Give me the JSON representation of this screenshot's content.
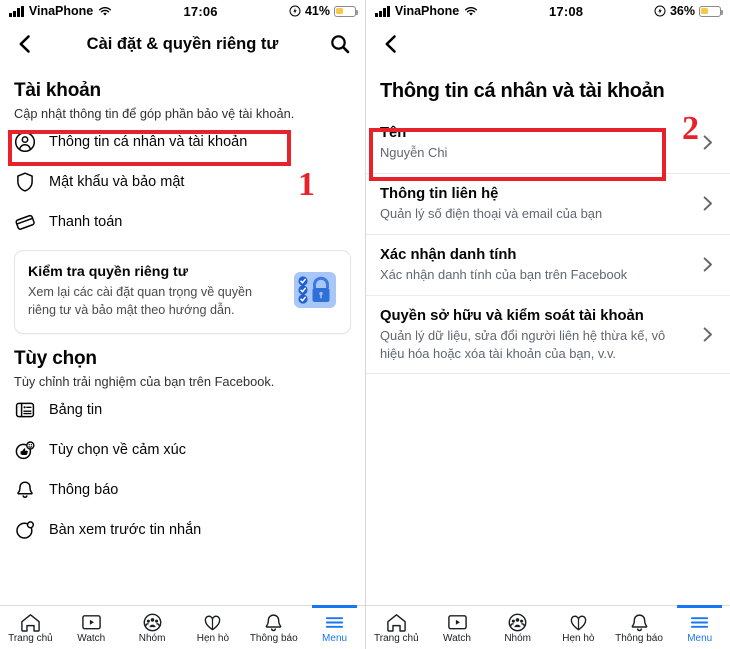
{
  "left": {
    "status": {
      "carrier": "VinaPhone",
      "time": "17:06",
      "battery_pct": "41%",
      "signal_icon": "signal-bars-icon",
      "wifi_icon": "wifi-icon",
      "battery_icon": "battery-icon",
      "lowpower_icon": "low-power-icon"
    },
    "nav": {
      "back_icon": "back-chevron-icon",
      "title": "Cài đặt & quyền riêng tư",
      "search_icon": "search-icon"
    },
    "account": {
      "title": "Tài khoản",
      "subtitle": "Cập nhật thông tin để góp phần bảo vệ tài khoản.",
      "items": [
        {
          "label": "Thông tin cá nhân và tài khoản",
          "icon": "person-circle-icon"
        },
        {
          "label": "Mật khẩu và bảo mật",
          "icon": "shield-icon"
        },
        {
          "label": "Thanh toán",
          "icon": "payment-card-icon"
        }
      ]
    },
    "privacy_card": {
      "title": "Kiểm tra quyền riêng tư",
      "desc": "Xem lại các cài đặt quan trọng về quyền riêng tư và bảo mật theo hướng dẫn.",
      "icon": "privacy-checkup-lock-icon"
    },
    "preferences": {
      "title": "Tùy chọn",
      "subtitle": "Tùy chỉnh trải nghiệm của bạn trên Facebook.",
      "items": [
        {
          "label": "Bảng tin",
          "icon": "newsfeed-icon"
        },
        {
          "label": "Tùy chọn về cảm xúc",
          "icon": "reactions-icon"
        },
        {
          "label": "Thông báo",
          "icon": "bell-icon"
        },
        {
          "label": "Bàn xem trước tin nhắn",
          "icon": "message-preview-icon"
        }
      ]
    },
    "annotation": {
      "number": "1"
    }
  },
  "right": {
    "status": {
      "carrier": "VinaPhone",
      "time": "17:08",
      "battery_pct": "36%",
      "signal_icon": "signal-bars-icon",
      "wifi_icon": "wifi-icon",
      "battery_icon": "battery-icon",
      "lowpower_icon": "low-power-icon"
    },
    "nav": {
      "back_icon": "back-chevron-icon"
    },
    "page_title": "Thông tin cá nhân và tài khoản",
    "rows": [
      {
        "title": "Tên",
        "sub": "Nguyễn Chi",
        "chevron": "chevron-right-icon"
      },
      {
        "title": "Thông tin liên hệ",
        "sub": "Quản lý số điện thoại và email của bạn",
        "chevron": "chevron-right-icon"
      },
      {
        "title": "Xác nhận danh tính",
        "sub": "Xác nhận danh tính của bạn trên Facebook",
        "chevron": "chevron-right-icon"
      },
      {
        "title": "Quyền sở hữu và kiểm soát tài khoản",
        "sub": "Quản lý dữ liệu, sửa đổi người liên hệ thừa kế, vô hiệu hóa hoặc xóa tài khoản của bạn, v.v.",
        "chevron": "chevron-right-icon"
      }
    ],
    "annotation": {
      "number": "2"
    }
  },
  "tabbar": {
    "items": [
      {
        "label": "Trang chủ",
        "icon": "home-icon",
        "active": false
      },
      {
        "label": "Watch",
        "icon": "watch-play-icon",
        "active": false
      },
      {
        "label": "Nhóm",
        "icon": "groups-icon",
        "active": false
      },
      {
        "label": "Hẹn hò",
        "icon": "dating-hearts-icon",
        "active": false
      },
      {
        "label": "Thông báo",
        "icon": "bell-icon",
        "active": false
      },
      {
        "label": "Menu",
        "icon": "hamburger-menu-icon",
        "active": true
      }
    ]
  },
  "colors": {
    "accent": "#1877f2",
    "annotation": "#e8222a",
    "battery": "#f7c948",
    "text": "#050505",
    "muted": "#606770"
  }
}
